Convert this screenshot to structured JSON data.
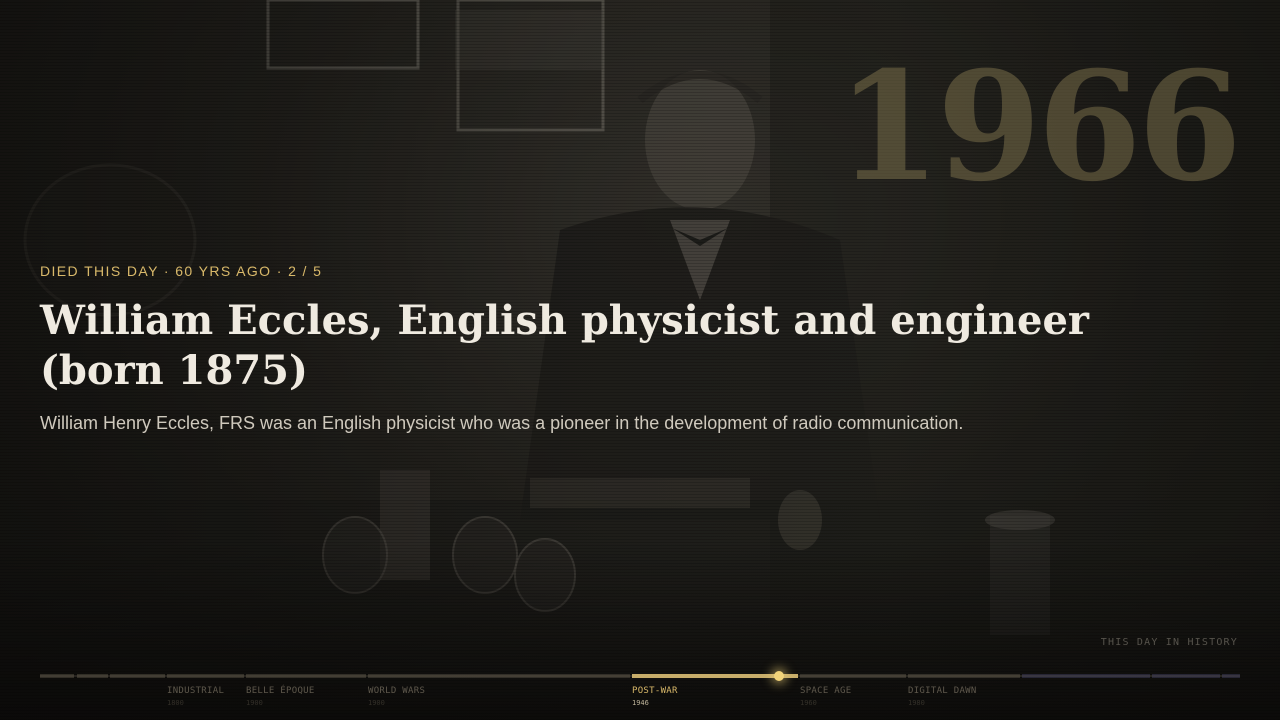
{
  "hero": {
    "year": "1966",
    "eyebrow": "DIED THIS DAY · 60 YRS AGO · 2 / 5",
    "title": "William Eccles, English physicist and engineer (born 1875)",
    "description": "William Henry Eccles, FRS was an English physicist who was a pioneer in the development of radio communication."
  },
  "brand": "THIS DAY IN HISTORY",
  "timeline": {
    "playhead_fraction": 0.616,
    "eras": [
      {
        "label": "INDUSTRIAL",
        "year": "1800",
        "active": false
      },
      {
        "label": "BELLE ÉPOQUE",
        "year": "1900",
        "active": false
      },
      {
        "label": "WORLD WARS",
        "year": "1900",
        "active": false
      },
      {
        "label": "POST-WAR",
        "year": "1946",
        "active": true
      },
      {
        "label": "SPACE AGE",
        "year": "1960",
        "active": false
      },
      {
        "label": "DIGITAL DAWN",
        "year": "1980",
        "active": false
      }
    ]
  },
  "colors": {
    "accent": "#d9b96a",
    "playhead": "#f1d37a"
  }
}
